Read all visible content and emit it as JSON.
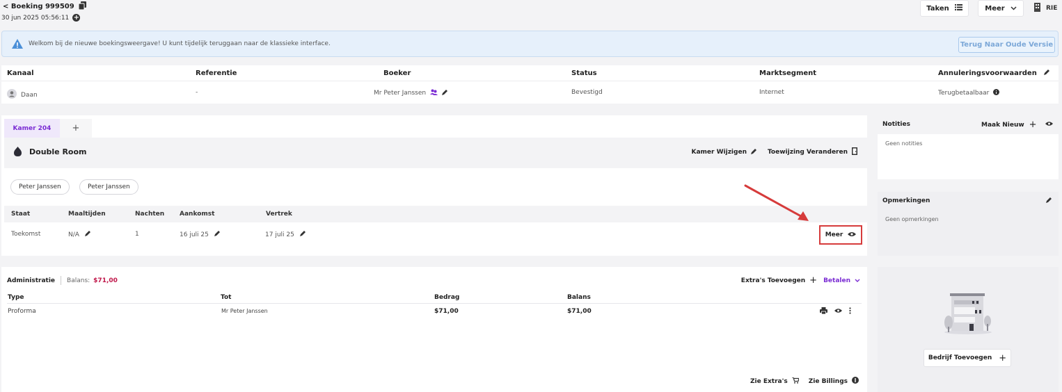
{
  "header": {
    "booking_title": "< Boeking 999509",
    "date": "30 jun 2025 05:56:11",
    "buttons": {
      "tasks": "Taken",
      "more": "Meer",
      "user": "RIE"
    }
  },
  "banner": {
    "message": "Welkom bij de nieuwe boekingsweergave! U kunt tijdelijk teruggaan naar de klassieke interface.",
    "button": "Terug Naar Oude Versie"
  },
  "info": {
    "headers": [
      "Kanaal",
      "Referentie",
      "Boeker",
      "Status",
      "Marktsegment",
      "Annuleringsvoorwaarden"
    ],
    "values": [
      "Daan",
      "-",
      "Mr Peter Janssen",
      "Bevestigd",
      "Internet",
      "Terugbetaalbaar"
    ]
  },
  "room": {
    "tab": "Kamer 204",
    "tab_add": "+",
    "name": "Double Room",
    "change_room": "Kamer Wijzigen",
    "change_assignment": "Toewijzing Veranderen",
    "guests": [
      "Peter Janssen",
      "Peter Janssen"
    ],
    "stay_headers": [
      "Staat",
      "Maaltijden",
      "Nachten",
      "Aankomst",
      "Vertrek"
    ],
    "stay_values": [
      "Toekomst",
      "N/A",
      "1",
      "16 juli 25",
      "17 juli 25"
    ],
    "more_button": "Meer"
  },
  "admin": {
    "title": "Administratie",
    "balance_label": "Balans:",
    "balance_value": "$71,00",
    "add_extras": "Extra's Toevoegen",
    "pay": "Betalen",
    "headers": [
      "Type",
      "Tot",
      "Bedrag",
      "Balans"
    ],
    "rows": [
      [
        "Proforma",
        "Mr Peter Janssen",
        "$71,00",
        "$71,00"
      ]
    ],
    "see_extras": "Zie Extra's",
    "see_billings": "Zie Billings"
  },
  "notes": {
    "title": "Notities",
    "create": "Maak Nieuw",
    "empty": "Geen notities"
  },
  "remarks": {
    "title": "Opmerkingen",
    "empty": "Geen opmerkingen"
  },
  "company": {
    "button": "Bedrijf Toevoegen"
  },
  "colors": {
    "accent_purple": "#7a2bd3",
    "balance_red": "#c0174a",
    "highlight_red": "#d63b3b",
    "banner_bg": "#e6f0fb"
  }
}
